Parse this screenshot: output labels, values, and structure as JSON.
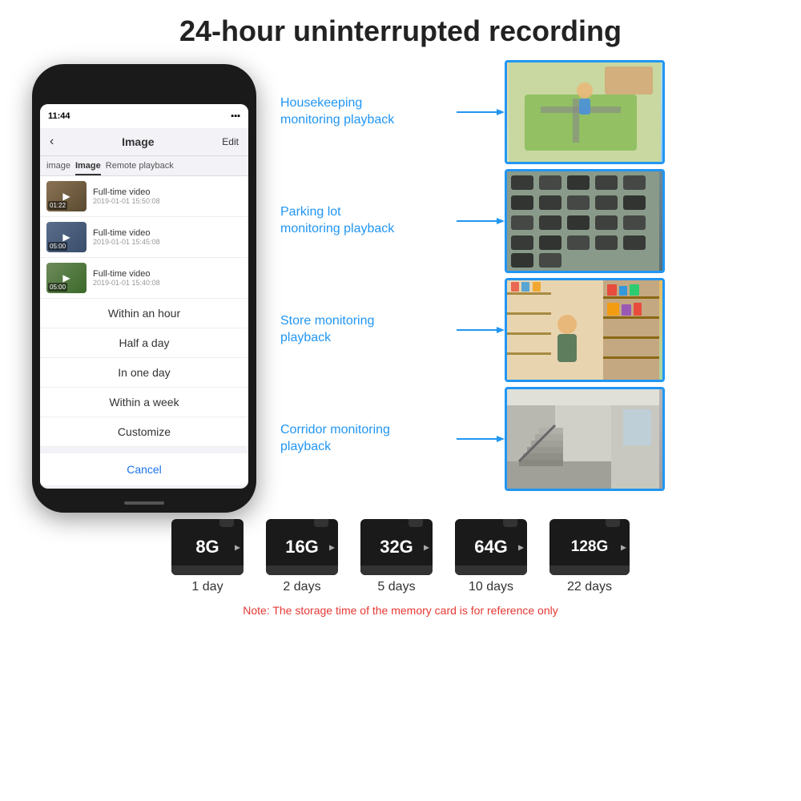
{
  "page": {
    "title": "24-hour uninterrupted recording",
    "bg_color": "#ffffff"
  },
  "phone": {
    "time": "11:44",
    "header_title": "Image",
    "back_label": "‹",
    "edit_label": "Edit",
    "tabs": [
      {
        "label": "image",
        "active": false
      },
      {
        "label": "Image",
        "active": true
      },
      {
        "label": "Remote playback",
        "active": false
      }
    ],
    "videos": [
      {
        "title": "Full-time video",
        "date": "2019-01-01 15:50:08",
        "duration": "01:22"
      },
      {
        "title": "Full-time video",
        "date": "2019-01-01 15:45:08",
        "duration": "05:00"
      },
      {
        "title": "Full-time video",
        "date": "2019-01-01 15:40:08",
        "duration": "05:00"
      }
    ],
    "dropdown_items": [
      "Within an hour",
      "Half a day",
      "In one day",
      "Within a week",
      "Customize"
    ],
    "cancel_label": "Cancel"
  },
  "monitoring": [
    {
      "label": "Housekeeping\nmonitoring playback",
      "image_type": "housekeeping"
    },
    {
      "label": "Parking lot\nmonitoring playback",
      "image_type": "parking"
    },
    {
      "label": "Store monitoring\nplayback",
      "image_type": "store"
    },
    {
      "label": "Corridor monitoring\nplayback",
      "image_type": "corridor"
    }
  ],
  "storage": {
    "cards": [
      {
        "size": "8G",
        "days": "1 day"
      },
      {
        "size": "16G",
        "days": "2 days"
      },
      {
        "size": "32G",
        "days": "5 days"
      },
      {
        "size": "64G",
        "days": "10 days"
      },
      {
        "size": "128G",
        "days": "22 days"
      }
    ],
    "note": "Note: The storage time of the memory card is for reference only"
  }
}
